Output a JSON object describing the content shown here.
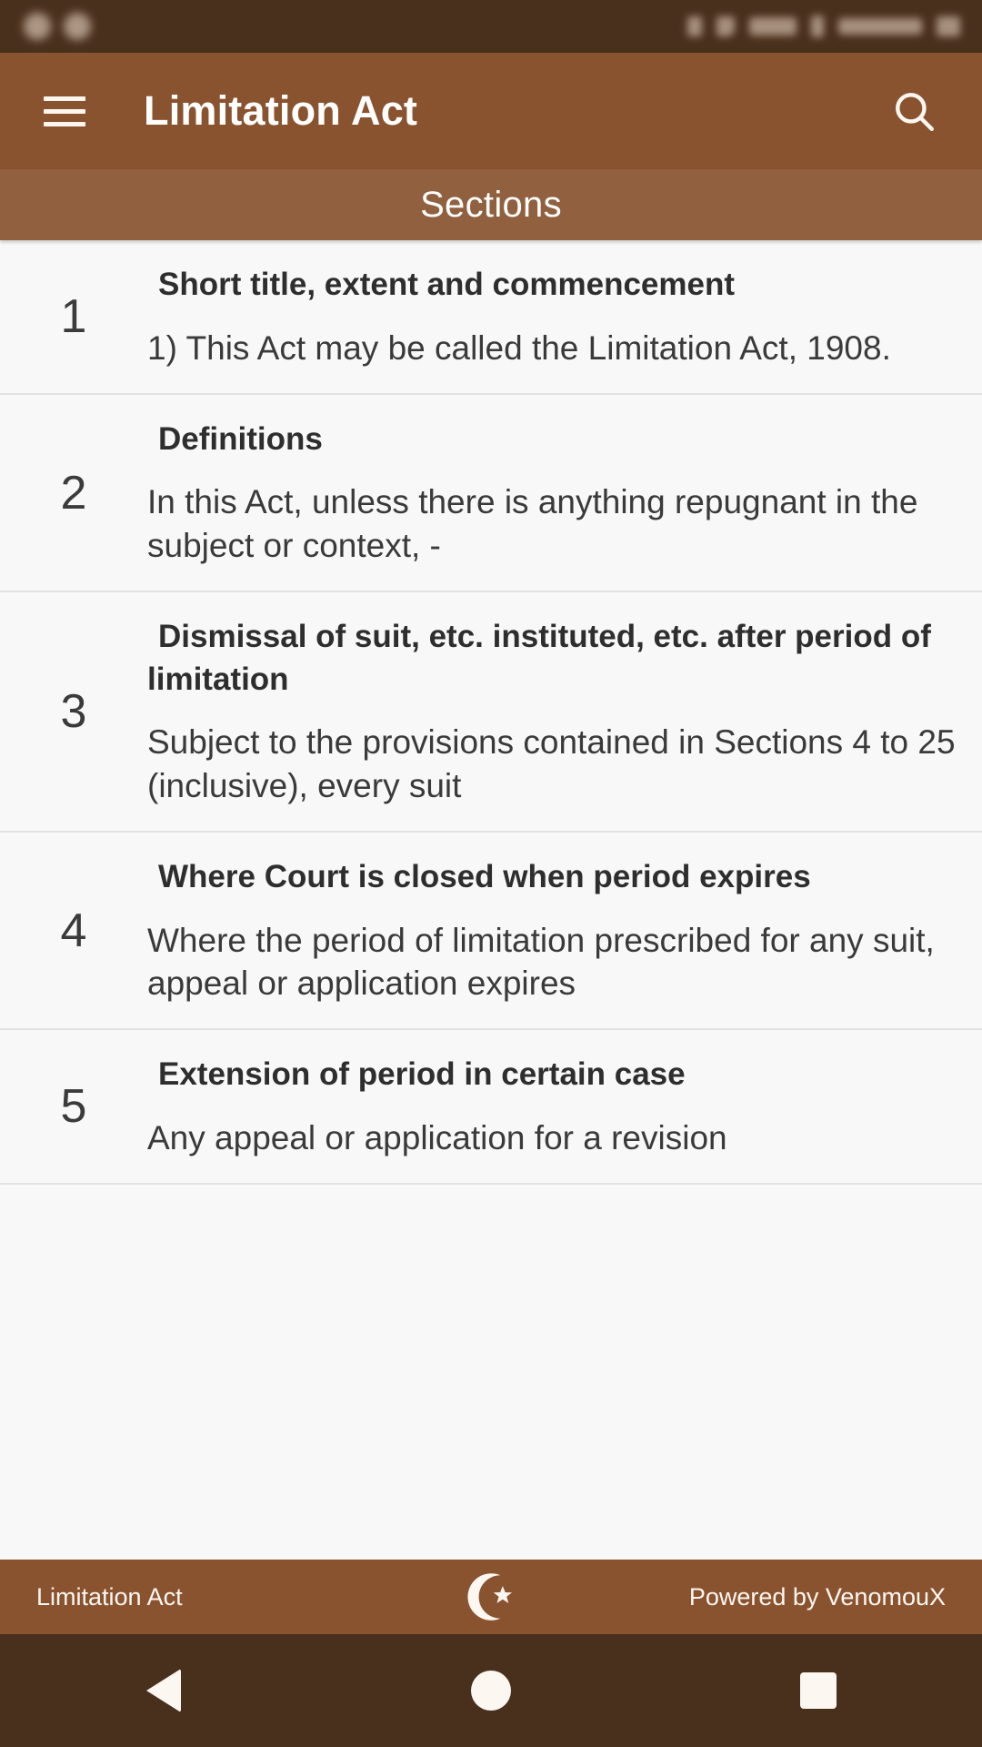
{
  "app": {
    "title": "Limitation Act",
    "menu_icon": "hamburger-menu-icon",
    "search_icon": "search-icon"
  },
  "sections_header": {
    "label": "Sections"
  },
  "sections": [
    {
      "number": "1",
      "title": "Short title, extent and commencement",
      "description": "1) This Act may be called the Limitation Act, 1908."
    },
    {
      "number": "2",
      "title": "Definitions",
      "description": "In this Act, unless there is anything repugnant in the subject or context, -"
    },
    {
      "number": "3",
      "title": "Dismissal of suit, etc. instituted, etc. after period of limitation",
      "description": "Subject to the provisions contained in Sections 4 to 25 (inclusive), every suit"
    },
    {
      "number": "4",
      "title": "Where Court is closed when period expires",
      "description": "Where the period of limitation prescribed for any suit, appeal or application expires"
    },
    {
      "number": "5",
      "title": "Extension of period in certain case",
      "description": "Any appeal or application for a revision"
    }
  ],
  "footer": {
    "left_label": "Limitation Act",
    "icon": "crescent-moon-star-icon",
    "right_label": "Powered by VenomouX"
  },
  "navigation": {
    "back": "back-button",
    "home": "home-button",
    "recents": "recents-button"
  },
  "colors": {
    "status_bar": "#49301d",
    "app_bar": "#8a5330",
    "sections_bar": "#90603f",
    "list_bg": "#f8f8f8",
    "footer_bar": "#8a5330",
    "nav_bar": "#49301d",
    "divider": "#e2e2e2",
    "title_text": "#2e2e2e"
  }
}
